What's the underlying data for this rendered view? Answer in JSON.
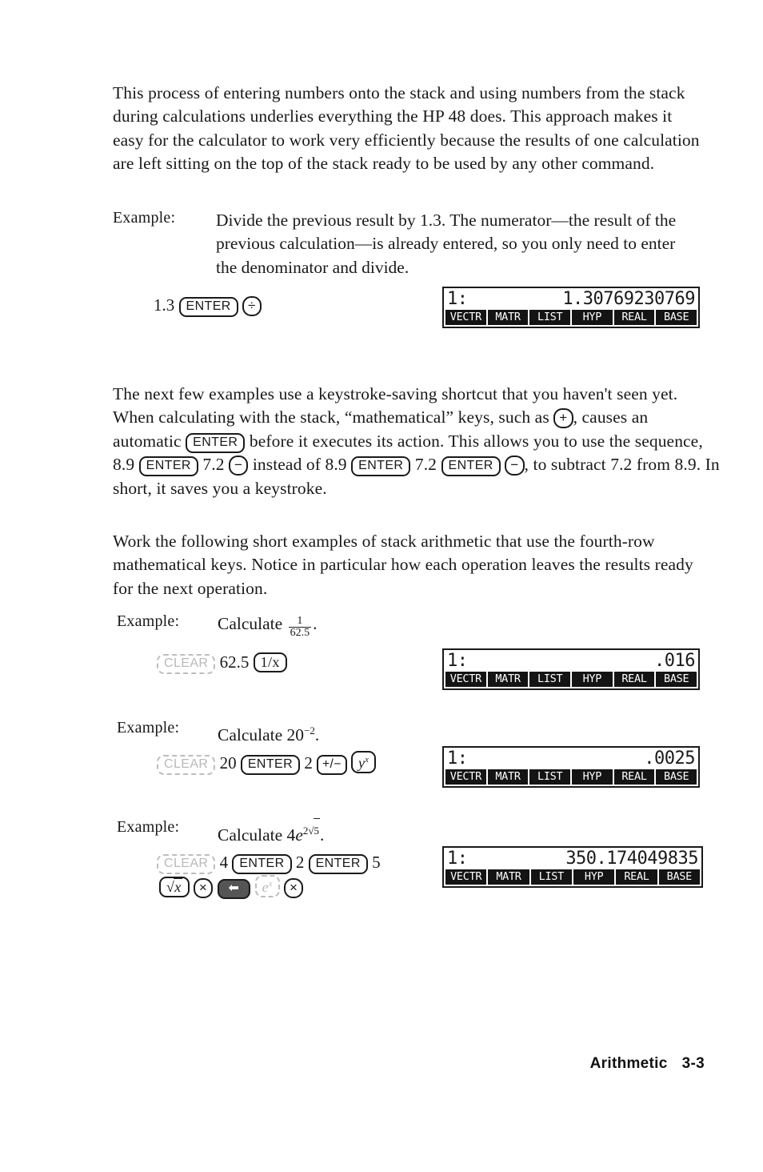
{
  "document": {
    "footer": {
      "section": "Arithmetic",
      "page": "3-3"
    }
  },
  "paragraphs": {
    "p1": "This process of entering numbers onto the stack and using numbers from the stack during calculations underlies everything the HP 48 does. This approach makes it easy for the calculator to work very efficiently because the results of one calculation are left sitting on the top of the stack ready to be used by any other command.",
    "p3_a": "The next few examples use a keystroke-saving shortcut that you haven't seen yet. When calculating with the stack, “mathematical” keys, such as ",
    "p3_b": ", causes an automatic ",
    "p3_c": " before it executes its action. This allows you to use the sequence, 8.9 ",
    "p3_d": " 7.2 ",
    "p3_e": " instead of 8.9 ",
    "p3_f": " 7.2 ",
    "p3_g": " ",
    "p3_h": ", to subtract 7.2 from 8.9. In short, it saves you a keystroke.",
    "p4": "Work the following short examples of stack arithmetic that use the fourth-row mathematical keys. Notice in particular how each operation leaves the results ready for the next operation."
  },
  "examples": [
    {
      "label": "Example:",
      "text": "Divide the previous result by 1.3. The numerator—the result of the previous calculation—is already entered, so you only need to enter the denominator and divide.",
      "keystrokes": [
        "1.3",
        "ENTER",
        "÷"
      ],
      "display": {
        "level": "1:",
        "value": "1.30769230769",
        "menu": [
          "VECTR",
          "MATR",
          "LIST",
          "HYP",
          "REAL",
          "BASE"
        ]
      }
    },
    {
      "label": "Example:",
      "calculate_prefix": "Calculate",
      "expression_numerator": "1",
      "expression_denominator": "62.5",
      "keystrokes": [
        "CLEAR",
        "62.5",
        "1/x"
      ],
      "display": {
        "level": "1:",
        "value": ".016",
        "menu": [
          "VECTR",
          "MATR",
          "LIST",
          "HYP",
          "REAL",
          "BASE"
        ]
      }
    },
    {
      "label": "Example:",
      "calculate_text": "Calculate 20",
      "exponent": "−2",
      "keystrokes": [
        "CLEAR",
        "20",
        "ENTER",
        "2",
        "+/−",
        "y"
      ],
      "key_exponent": "x",
      "display": {
        "level": "1:",
        "value": ".0025",
        "menu": [
          "VECTR",
          "MATR",
          "LIST",
          "HYP",
          "REAL",
          "BASE"
        ]
      }
    },
    {
      "label": "Example:",
      "calculate_text": "Calculate 4",
      "base_italic": "e",
      "exponent_coef": "2",
      "exponent_root": "5",
      "keystrokes_row1": [
        "CLEAR",
        "4",
        "ENTER",
        "2",
        "ENTER",
        "5"
      ],
      "keystrokes_row2": [
        "√x",
        "×",
        "left-shift",
        "e^x",
        "×"
      ],
      "display": {
        "level": "1:",
        "value": "350.174049835",
        "menu": [
          "VECTR",
          "MATR",
          "LIST",
          "HYP",
          "REAL",
          "BASE"
        ]
      }
    }
  ],
  "keys": {
    "enter": "ENTER",
    "clear": "CLEAR",
    "divide": "÷",
    "plus": "+",
    "minus": "−",
    "multiply": "×",
    "inverse": "1/x",
    "plusminus": "+/−",
    "power_base": "y",
    "power_exp": "x",
    "sqrt": "√",
    "sqrt_var": "x",
    "exp_e": "e",
    "exp_sup": "x"
  }
}
